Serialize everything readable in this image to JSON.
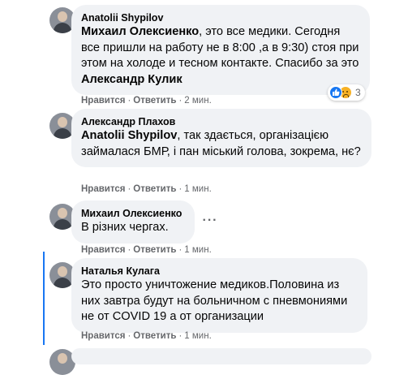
{
  "comments": [
    {
      "author": "Anatolii Shypilov",
      "mention": "Михаил Олексиенко",
      "text": ", это все медики. Сегодня все пришли на работу не в 8:00 ,а в 9:30) стоя при этом на холоде и тесном контакте. Спасибо за это ",
      "mention_end": "Александр Кулик",
      "reaction_count": "3",
      "reaction_icons": [
        "like-icon",
        "sad-icon"
      ],
      "like": "Нравится",
      "reply": "Ответить",
      "time": "2 мин."
    },
    {
      "author": "Александр Плахов",
      "mention": "Anatolii Shypilov",
      "text": ", так здається, організацією займалася БМР, і пан міський голова, зокрема, нє?",
      "like": "Нравится",
      "reply": "Ответить",
      "time": "1 мин."
    },
    {
      "author": "Михаил Олексиенко",
      "text": "В різних чергах.",
      "like": "Нравится",
      "reply": "Ответить",
      "time": "1 мин."
    },
    {
      "author": "Наталья Кулага",
      "text": "Это просто уничтожение медиков.Половина из них завтра будут на больничном с пневмониями не от COVID 19 а от организации",
      "like": "Нравится",
      "reply": "Ответить",
      "time": "1 мин."
    }
  ],
  "separator": "·",
  "more_glyph": "···",
  "colors": {
    "bubble": "#f0f2f5",
    "secondary_text": "#65676b",
    "accent": "#1877f2"
  }
}
